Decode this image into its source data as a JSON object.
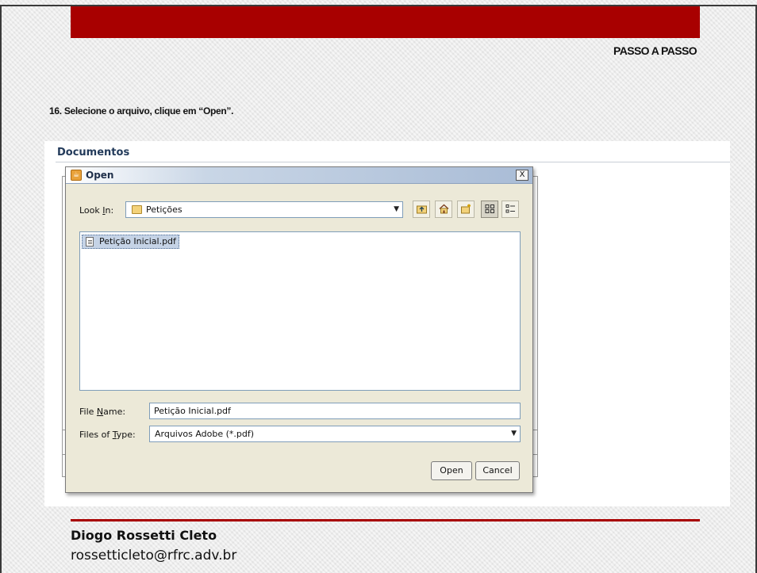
{
  "slide": {
    "section_label": "PASSO A PASSO",
    "step_text": "16. Selecione o arquivo, clique em “Open”.",
    "author": "Diogo Rossetti Cleto",
    "email": "rossetticleto@rfrc.adv.br",
    "accent_color": "#a80000"
  },
  "app": {
    "section_title": "Documentos"
  },
  "dialog": {
    "title": "Open",
    "close_label": "X",
    "look_in_label_pre": "Look ",
    "look_in_label_u": "I",
    "look_in_label_post": "n:",
    "look_in_value": "Petições",
    "toolbar": {
      "up_one_level": "up-folder-icon",
      "home": "home-icon",
      "new_folder": "new-folder-icon",
      "list_view": "list-view-icon",
      "details_view": "details-view-icon"
    },
    "files": [
      {
        "name": "Petição Inicial.pdf",
        "selected": true
      }
    ],
    "file_name_label_pre": "File ",
    "file_name_label_u": "N",
    "file_name_label_post": "ame:",
    "file_name_value": "Petição Inicial.pdf",
    "files_of_type_label_pre": "Files of ",
    "files_of_type_label_u": "T",
    "files_of_type_label_post": "ype:",
    "files_of_type_value": "Arquivos Adobe (*.pdf)",
    "open_button": "Open",
    "cancel_button": "Cancel"
  }
}
